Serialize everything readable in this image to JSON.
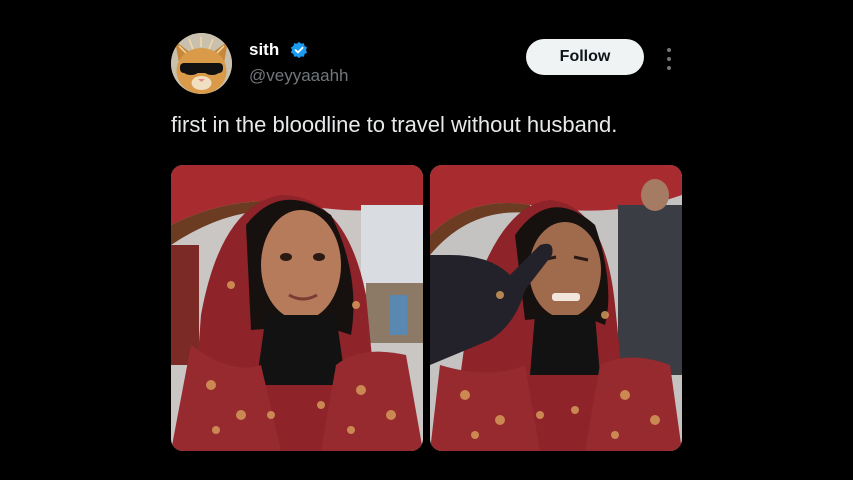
{
  "tweet": {
    "author": {
      "name": "sith",
      "handle": "@veyyaaahh",
      "verified": true,
      "avatar_icon": "cat-with-sunglasses-avatar"
    },
    "follow_label": "Follow",
    "text": "first in the bloodline to travel without husband.",
    "media": [
      {
        "description_icon": "selfie-photo-smiling"
      },
      {
        "description_icon": "selfie-photo-grimace"
      }
    ]
  },
  "colors": {
    "background": "#000000",
    "text": "#e7e9ea",
    "secondary": "#71767b",
    "verified": "#1d9bf0",
    "button_bg": "#eff3f4"
  }
}
